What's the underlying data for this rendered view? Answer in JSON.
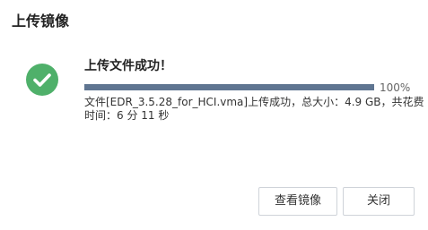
{
  "dialog": {
    "title": "上传镜像",
    "success_title": "上传文件成功！",
    "progress": {
      "percent": 100,
      "label": "100%"
    },
    "detail_line1": "文件[EDR_3.5.28_for_HCI.vma]上传成功，总大小：4.9 GB，共花费",
    "detail_line2": "时间：6 分 11 秒",
    "buttons": {
      "view_image": "查看镜像",
      "close": "关闭"
    },
    "colors": {
      "success_icon": "#4fb06a",
      "progress_fill": "#5f7591",
      "progress_track": "#e5e8ee"
    },
    "icons": {
      "status": "check-circle-icon"
    }
  }
}
